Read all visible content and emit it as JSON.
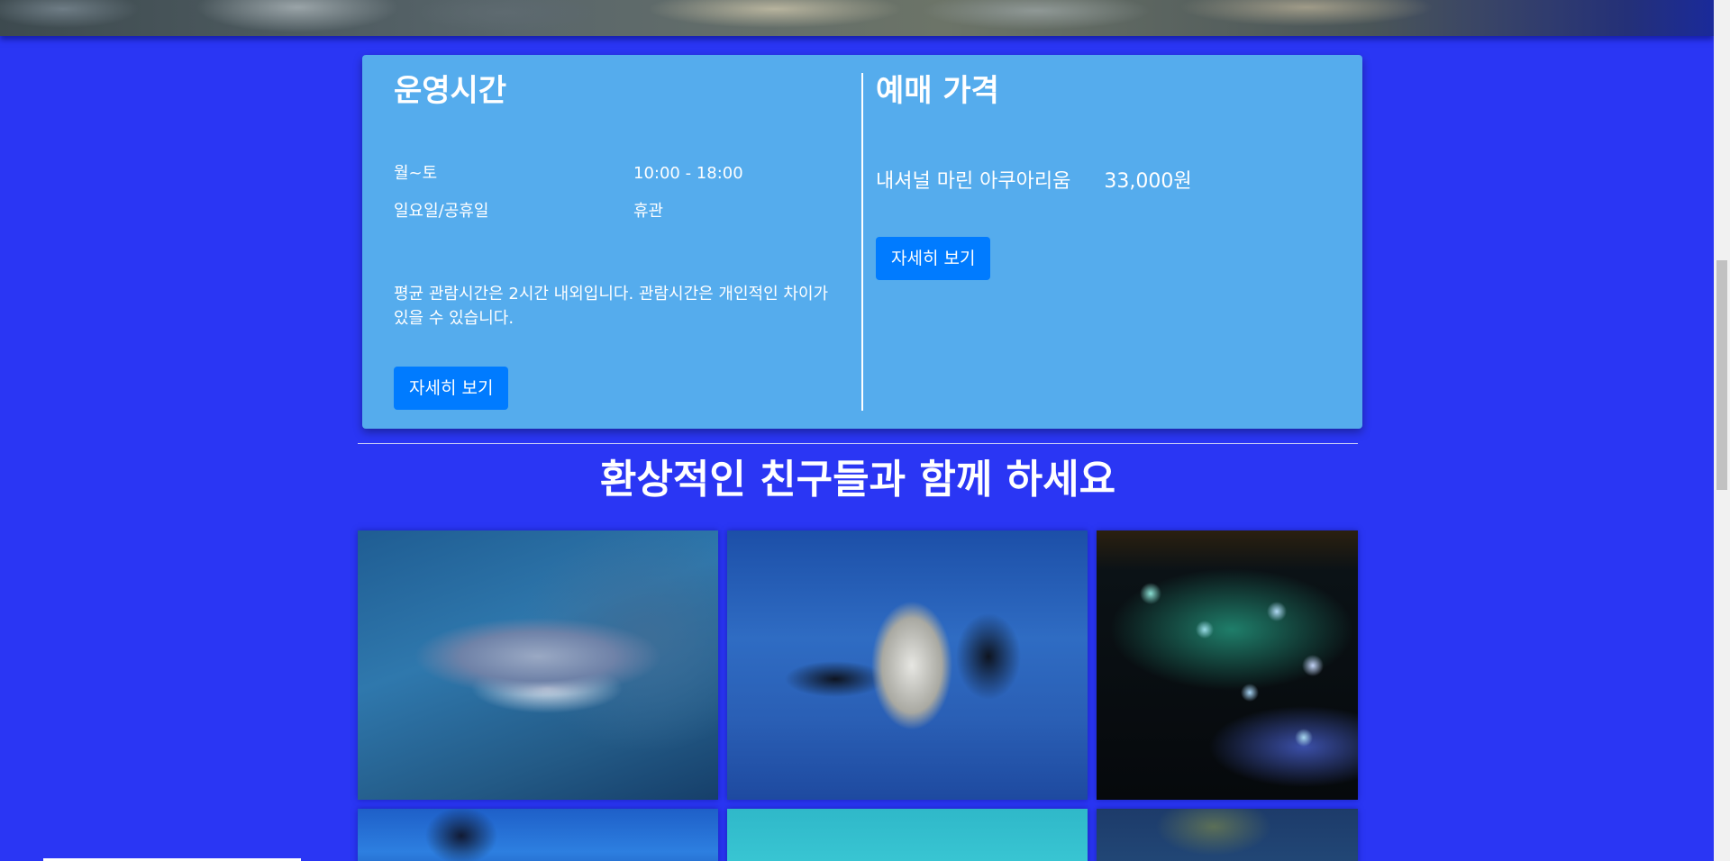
{
  "hours": {
    "title": "운영시간",
    "rows": [
      {
        "day": "월~토",
        "time": "10:00 - 18:00"
      },
      {
        "day": "일요일/공휴일",
        "time": "휴관"
      }
    ],
    "note": "평균 관람시간은 2시간 내외입니다. 관람시간은 개인적인 차이가 있을 수 있습니다.",
    "detail_button": "자세히 보기"
  },
  "tickets": {
    "title": "예매 가격",
    "price_name": "내셔널 마린 아쿠아리움",
    "price_value": "33,000원",
    "detail_button": "자세히 보기"
  },
  "gallery": {
    "title": "환상적인 친구들과 함께 하세요"
  },
  "colors": {
    "page_background": "#2a36f4",
    "card_background": "#55aced",
    "button": "#007bff"
  }
}
